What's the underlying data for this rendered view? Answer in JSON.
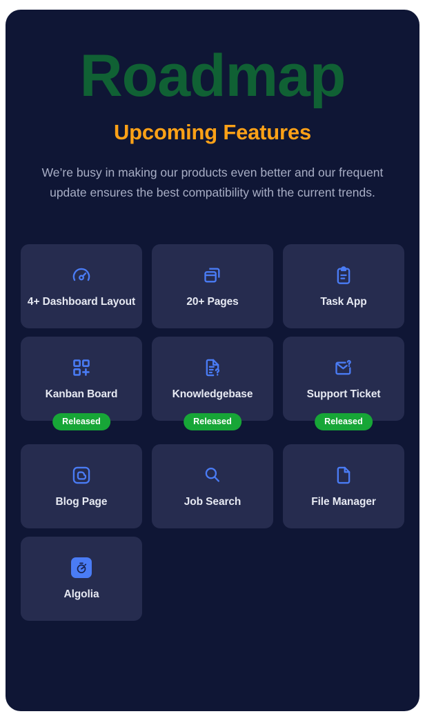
{
  "hero": {
    "title": "Roadmap",
    "subtitle": "Upcoming Features",
    "description": "We’re busy in making our products even better and our frequent update ensures the best compatibility with the current trends."
  },
  "colors": {
    "panel_background": "#0f1635",
    "card_background": "#262c4f",
    "title_green": "#106134",
    "subtitle_orange": "#fda117",
    "icon_blue": "#4a7cf5",
    "badge_green": "#17a637",
    "description_text": "#a8aec5",
    "card_label": "#e6e9f2"
  },
  "features": [
    {
      "label": "4+ Dashboard Layout",
      "icon": "gauge-icon",
      "badge": null
    },
    {
      "label": "20+ Pages",
      "icon": "stacked-windows-icon",
      "badge": null
    },
    {
      "label": "Task App",
      "icon": "clipboard-icon",
      "badge": null
    },
    {
      "label": "Kanban Board",
      "icon": "grid-plus-icon",
      "badge": "Released"
    },
    {
      "label": "Knowledgebase",
      "icon": "document-question-icon",
      "badge": "Released"
    },
    {
      "label": "Support Ticket",
      "icon": "envelope-question-icon",
      "badge": "Released"
    },
    {
      "label": "Blog Page",
      "icon": "blogger-icon",
      "badge": null
    },
    {
      "label": "Job Search",
      "icon": "magnifier-icon",
      "badge": null
    },
    {
      "label": "File Manager",
      "icon": "file-icon",
      "badge": null
    },
    {
      "label": "Algolia",
      "icon": "algolia-stopwatch-icon",
      "badge": null
    }
  ]
}
